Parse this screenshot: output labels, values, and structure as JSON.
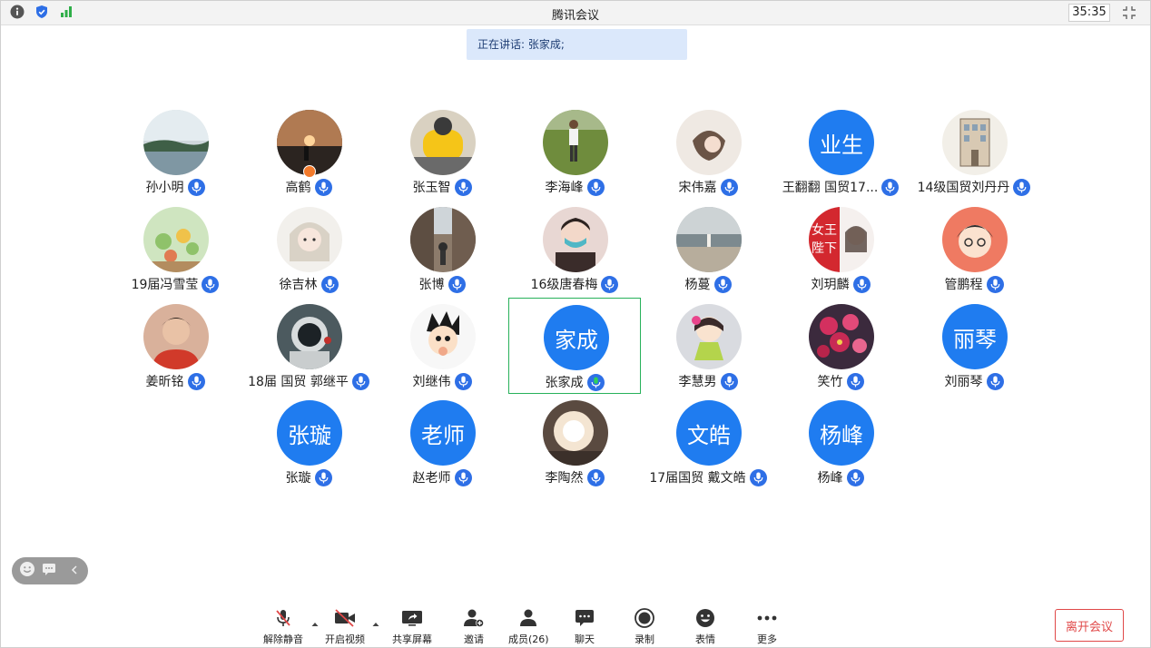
{
  "titlebar": {
    "title": "腾讯会议",
    "timer": "35:35",
    "icons": [
      "info-icon",
      "shield-icon",
      "signal-icon"
    ]
  },
  "banner": {
    "speaking_text": "正在讲话: 张家成;"
  },
  "participants": [
    {
      "name": "孙小明",
      "avatar": "lake-photo"
    },
    {
      "name": "高鹤",
      "avatar": "sunset-photo"
    },
    {
      "name": "张玉智",
      "avatar": "cartoon-photo"
    },
    {
      "name": "李海峰",
      "avatar": "field-photo"
    },
    {
      "name": "宋伟嘉",
      "avatar": "girl-sketch-photo"
    },
    {
      "name": "王翻翻 国贸17...",
      "avatar_text": "业生"
    },
    {
      "name": "14级国贸刘丹丹",
      "avatar": "building-photo"
    },
    {
      "name": "19届冯雪莹",
      "avatar": "cartoon-frogs-photo"
    },
    {
      "name": "徐吉林",
      "avatar": "anime-girl-photo"
    },
    {
      "name": "张博",
      "avatar": "street-photo"
    },
    {
      "name": "16级唐春梅",
      "avatar": "mask-photo"
    },
    {
      "name": "杨蔓",
      "avatar": "beach-photo"
    },
    {
      "name": "刘玥麟",
      "avatar": "poster-photo"
    },
    {
      "name": "管鹏程",
      "avatar": "cartoon-boy-photo"
    },
    {
      "name": "姜昕铭",
      "avatar": "man-photo"
    },
    {
      "name": "18届 国贸 郭继平",
      "avatar": "astronaut-photo"
    },
    {
      "name": "刘继伟",
      "avatar": "astroboy-photo"
    },
    {
      "name": "张家成",
      "avatar_text": "家成",
      "speaking": true
    },
    {
      "name": "李慧男",
      "avatar": "cartoon-girl-photo"
    },
    {
      "name": "笑竹",
      "avatar": "flowers-photo"
    },
    {
      "name": "刘丽琴",
      "avatar_text": "丽琴"
    },
    {
      "name": "张璇",
      "avatar_text": "张璇"
    },
    {
      "name": "赵老师",
      "avatar_text": "老师"
    },
    {
      "name": "李陶然",
      "avatar": "light-photo"
    },
    {
      "name": "17届国贸 戴文皓",
      "avatar_text": "文皓"
    },
    {
      "name": "杨峰",
      "avatar_text": "杨峰"
    }
  ],
  "toolbar": {
    "unmute": "解除静音",
    "start_video": "开启视频",
    "share_screen": "共享屏幕",
    "invite": "邀请",
    "members": "成员(26)",
    "chat": "聊天",
    "record": "录制",
    "reactions": "表情",
    "more": "更多",
    "leave": "离开会议"
  },
  "colors": {
    "avatar_blue": "#1f7cf0",
    "mic_blue": "#2e6fe6",
    "active_border": "#27b15a",
    "leave_red": "#e04848",
    "banner_bg": "#dbe8fb"
  }
}
